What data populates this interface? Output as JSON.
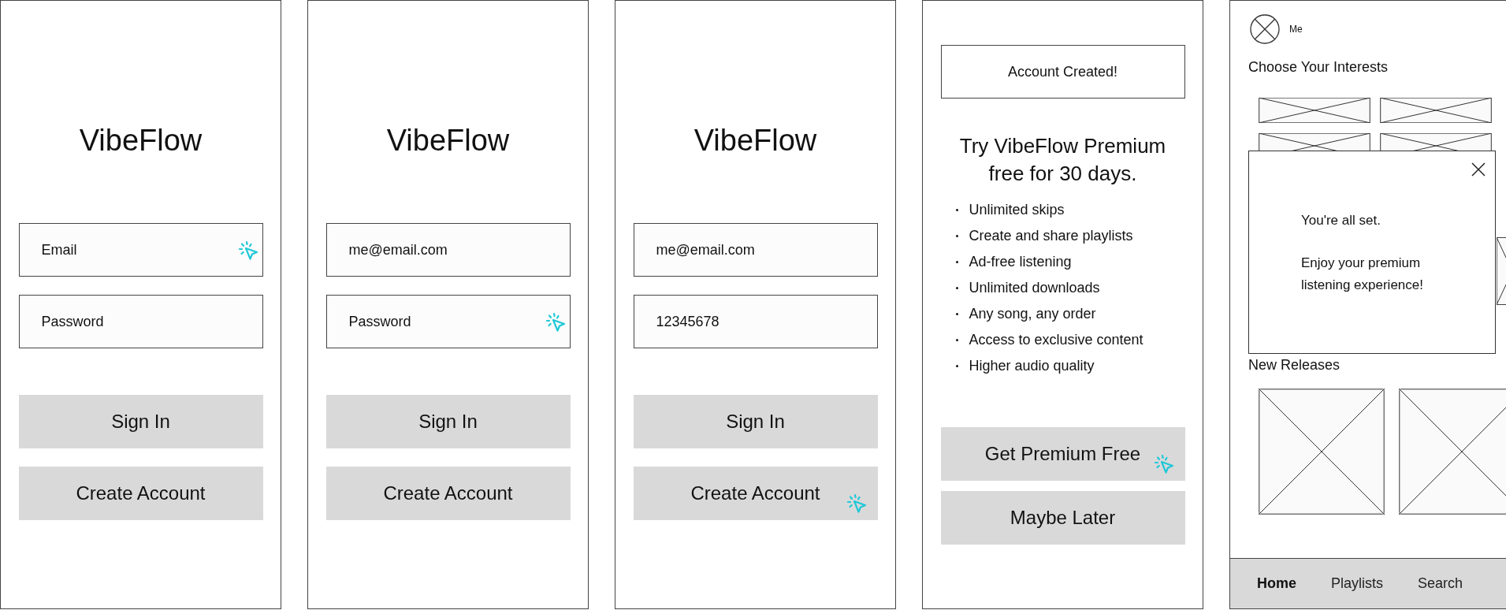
{
  "screens": [
    {
      "kind": "login",
      "title": "VibeFlow",
      "fields": [
        {
          "placeholder": "Email",
          "cursor": true
        },
        {
          "placeholder": "Password",
          "cursor": false
        }
      ],
      "buttons": [
        {
          "label": "Sign In",
          "cursor": false
        },
        {
          "label": "Create Account",
          "cursor": false
        }
      ]
    },
    {
      "kind": "login",
      "title": "VibeFlow",
      "fields": [
        {
          "value": "me@email.com",
          "cursor": false
        },
        {
          "placeholder": "Password",
          "cursor": true
        }
      ],
      "buttons": [
        {
          "label": "Sign In",
          "cursor": false
        },
        {
          "label": "Create Account",
          "cursor": false
        }
      ]
    },
    {
      "kind": "login",
      "title": "VibeFlow",
      "fields": [
        {
          "value": "me@email.com",
          "cursor": false
        },
        {
          "value": "12345678",
          "cursor": false
        }
      ],
      "buttons": [
        {
          "label": "Sign In",
          "cursor": false
        },
        {
          "label": "Create Account",
          "cursor": true
        }
      ]
    },
    {
      "kind": "offer",
      "banner": "Account Created!",
      "heading": "Try VibeFlow Premium free for 30 days.",
      "features": [
        "Unlimited skips",
        "Create and share playlists",
        "Ad-free listening",
        "Unlimited downloads",
        "Any song, any order",
        "Access to exclusive content",
        "Higher audio quality"
      ],
      "buttons": [
        {
          "label": "Get Premium Free",
          "cursor": true
        },
        {
          "label": "Maybe Later",
          "cursor": false
        }
      ]
    },
    {
      "kind": "home",
      "profile_label": "Me",
      "sections": [
        {
          "title": "Choose Your Interests"
        },
        {
          "title": "New Releases"
        }
      ],
      "dialog": {
        "lines": [
          "You're all set.",
          "Enjoy your premium listening experience!"
        ]
      },
      "nav": [
        {
          "label": "Home",
          "selected": true
        },
        {
          "label": "Playlists",
          "selected": false
        },
        {
          "label": "Search",
          "selected": false
        }
      ]
    }
  ]
}
